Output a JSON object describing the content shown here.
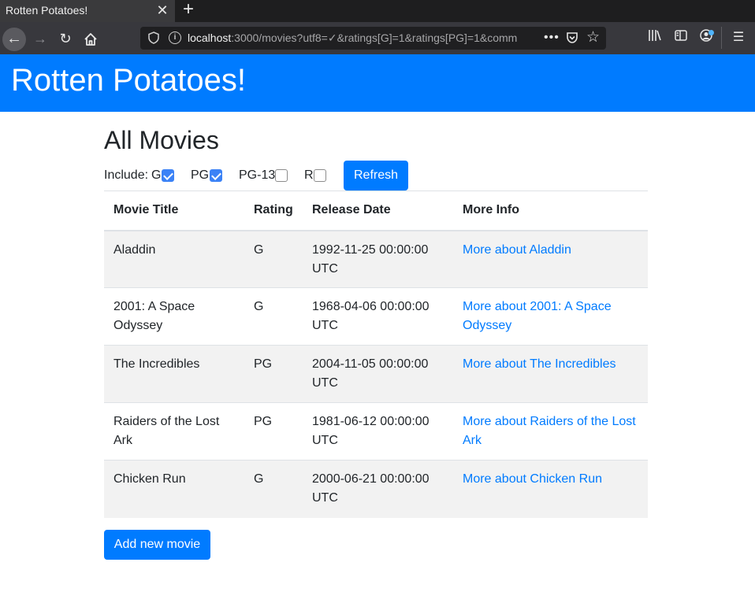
{
  "browser": {
    "tab_title": "Rotten Potatoes!",
    "tab_close": "✕",
    "new_tab": "+",
    "url_host": "localhost",
    "url_rest": ":3000/movies?utf8=✓&ratings[G]=1&ratings[PG]=1&comm",
    "more": "•••"
  },
  "app": {
    "title": "Rotten Potatoes!"
  },
  "page": {
    "heading": "All Movies",
    "filter": {
      "include_label": "Include:",
      "ratings": [
        {
          "label": "G",
          "checked": true
        },
        {
          "label": "PG",
          "checked": true
        },
        {
          "label": "PG-13",
          "checked": false
        },
        {
          "label": "R",
          "checked": false
        }
      ],
      "refresh_label": "Refresh"
    },
    "table": {
      "headers": [
        "Movie Title",
        "Rating",
        "Release Date",
        "More Info"
      ],
      "rows": [
        {
          "title": "Aladdin",
          "rating": "G",
          "release": "1992-11-25 00:00:00 UTC",
          "link": "More about Aladdin"
        },
        {
          "title": "2001: A Space Odyssey",
          "rating": "G",
          "release": "1968-04-06 00:00:00 UTC",
          "link": "More about 2001: A Space Odyssey"
        },
        {
          "title": "The Incredibles",
          "rating": "PG",
          "release": "2004-11-05 00:00:00 UTC",
          "link": "More about The Incredibles"
        },
        {
          "title": "Raiders of the Lost Ark",
          "rating": "PG",
          "release": "1981-06-12 00:00:00 UTC",
          "link": "More about Raiders of the Lost Ark"
        },
        {
          "title": "Chicken Run",
          "rating": "G",
          "release": "2000-06-21 00:00:00 UTC",
          "link": "More about Chicken Run"
        }
      ]
    },
    "add_label": "Add new movie"
  },
  "colors": {
    "brand": "#007bff",
    "checkbox": "#3b82f6",
    "stripe": "#f2f2f2"
  }
}
